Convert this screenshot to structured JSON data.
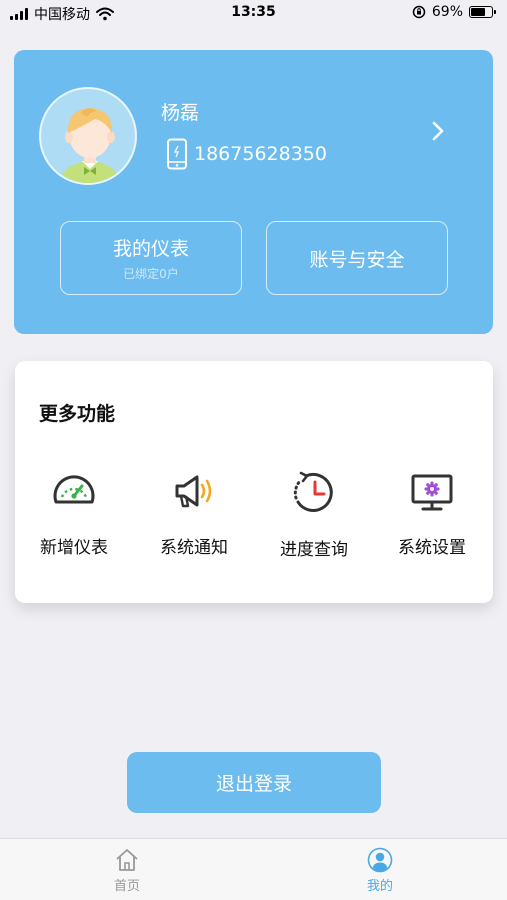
{
  "status_bar": {
    "carrier": "中国移动",
    "time": "13:35",
    "battery": "69%",
    "battery_level": 0.69,
    "icons": [
      "signal-icon",
      "wifi-icon",
      "rotation-lock-icon",
      "battery-icon"
    ]
  },
  "profile": {
    "name": "杨磊",
    "phone": "18675628350",
    "my_meters_label": "我的仪表",
    "my_meters_sub": "已绑定0户",
    "account_security_label": "账号与安全"
  },
  "features": {
    "title": "更多功能",
    "items": [
      {
        "label": "新增仪表",
        "icon": "gauge-icon"
      },
      {
        "label": "系统通知",
        "icon": "megaphone-icon"
      },
      {
        "label": "进度查询",
        "icon": "history-clock-icon"
      },
      {
        "label": "系统设置",
        "icon": "monitor-gear-icon"
      }
    ]
  },
  "logout_label": "退出登录",
  "tabs": [
    {
      "label": "首页",
      "icon": "home-icon",
      "active": false
    },
    {
      "label": "我的",
      "icon": "user-icon",
      "active": true
    }
  ],
  "colors": {
    "primary": "#6cbcef",
    "active_tab": "#4aa8e6",
    "background": "#f0eff4",
    "accent_green": "#3ab34a",
    "accent_orange": "#f5a623",
    "accent_red": "#e53935",
    "accent_purple": "#a64ad8"
  }
}
